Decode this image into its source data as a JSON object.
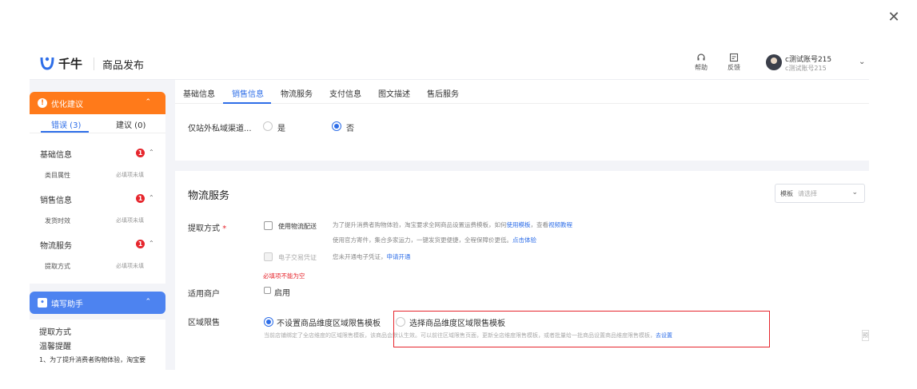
{
  "window": {
    "close_label": "✕"
  },
  "header": {
    "logo_text": "千牛",
    "title": "商品发布",
    "help_label": "帮助",
    "feedback_label": "反馈",
    "account_name": "c测试账号215",
    "account_sub": "c测试账号215"
  },
  "sidebar": {
    "optimize": {
      "title": "优化建议",
      "tab_errors": "错误 (3)",
      "tab_suggestions": "建议 (0)",
      "groups": [
        {
          "label": "基础信息",
          "badge": "1",
          "sub_label": "类目属性",
          "sub_status": "必填项未填"
        },
        {
          "label": "销售信息",
          "badge": "1",
          "sub_label": "发货时效",
          "sub_status": "必填项未填"
        },
        {
          "label": "物流服务",
          "badge": "1",
          "sub_label": "提取方式",
          "sub_status": "必填项未填"
        }
      ]
    },
    "helper": {
      "title": "填写助手",
      "line1": "提取方式",
      "line2": "温馨提醒",
      "note": "1、为了提升消费者购物体验，淘宝要"
    }
  },
  "main": {
    "tabs": [
      "基础信息",
      "销售信息",
      "物流服务",
      "支付信息",
      "图文描述",
      "售后服务"
    ],
    "private_channel": {
      "label": "仅站外私域渠道...",
      "option_yes": "是",
      "option_no": "否",
      "selected": "否"
    },
    "logistics": {
      "section_title": "物流服务",
      "template_prefix": "模板",
      "template_placeholder": "请选择",
      "pickup_label": "提取方式",
      "pickup_required": "*",
      "use_logistics": "使用物流配送",
      "logistics_note_pre": "为了提升消费者购物体验，淘宝要求全网商品设置运费模板，如何",
      "logistics_note_link1": "使用模板",
      "logistics_note_mid": "，查看",
      "logistics_note_link2": "视频教程",
      "logistics_note2_pre": "使用官方寄件，集合多家运力，一键发货更便捷，全程保障价更低。",
      "logistics_note2_link": "点击体验",
      "e_voucher": "电子交易凭证",
      "e_voucher_note": "您未开通电子凭证，",
      "e_voucher_link": "申请开通",
      "required_error": "必填项不能为空",
      "merchant_label": "适用商户",
      "merchant_enable": "启用",
      "region_label": "区域限售",
      "region_opt1": "不设置商品维度区域限售模板",
      "region_opt2": "选择商品维度区域限售模板",
      "region_note_pre": "当前店铺绑定了全店维度的区域限售模板，该商品会默认生效。可以前往区域限售页面，更新全店维度限售模板，或者批量给一批商品设置商品维度限售模板，",
      "region_note_link": "去设置",
      "edge_label": "预"
    }
  },
  "colors": {
    "accent_blue": "#2e6ee8",
    "orange": "#ff7a1a",
    "helper_blue": "#4d83f0",
    "error_red": "#e6262d"
  }
}
